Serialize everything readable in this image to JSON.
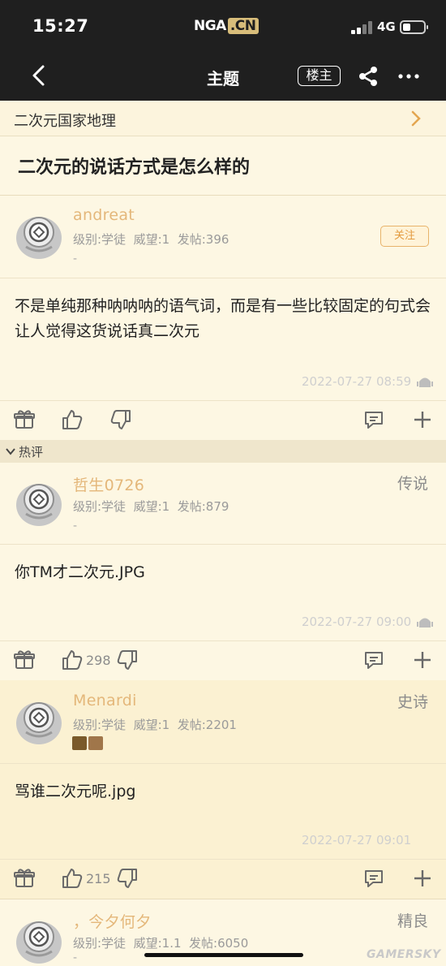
{
  "status_bar": {
    "time": "15:27",
    "app_logo": "NGA",
    "app_logo_suffix": ".CN",
    "network": "4G",
    "icons": [
      "signal-bars-icon",
      "battery-icon"
    ]
  },
  "nav": {
    "back_icon": "chevron-left-icon",
    "title": "主题",
    "owner_button": "楼主",
    "share_icon": "share-icon",
    "more_icon": "more-dots-icon"
  },
  "breadcrumb": {
    "label": "二次元国家地理",
    "chevron_icon": "chevron-right-icon"
  },
  "topic": {
    "title": "二次元的说话方式是怎么样的"
  },
  "hot_section": {
    "label": "热评"
  },
  "posts": [
    {
      "username": "andreat",
      "meta": "级别:学徒  威望:1  发帖:396",
      "dash": "-",
      "follow_label": "关注",
      "content": "不是单纯那种呐呐呐的语气词，而是有一些比较固定的句式会让人觉得这货说话真二次元",
      "timestamp": "2022-07-27 08:59"
    },
    {
      "username": "哲生0726",
      "rank": "传说",
      "meta": "级别:学徒  威望:1  发帖:879",
      "dash": "-",
      "content": "你TM才二次元.JPG",
      "timestamp": "2022-07-27 09:00",
      "likes": "298"
    },
    {
      "username": "Menardi",
      "rank": "史诗",
      "meta": "级别:学徒  威望:1  发帖:2201",
      "content": "骂谁二次元呢.jpg",
      "timestamp": "2022-07-27 09:01",
      "likes": "215"
    },
    {
      "username": "，今夕何夕",
      "rank": "精良",
      "meta": "级别:学徒  威望:1.1  发帖:6050",
      "dash": "-"
    }
  ],
  "watermark": "GAMERSKY",
  "colors": {
    "background": "#fdf7e3",
    "header": "#1f1f1f",
    "username": "#e4b77a",
    "follow_accent": "#e39a3e"
  }
}
